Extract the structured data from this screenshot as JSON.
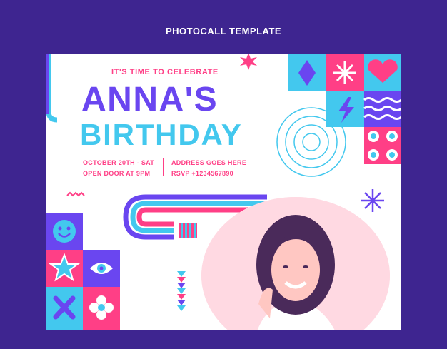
{
  "header": {
    "title": "PHOTOCALL TEMPLATE"
  },
  "card": {
    "kicker": "IT'S TIME TO CELEBRATE",
    "name": "ANNA'S",
    "title": "BIRTHDAY",
    "date_line": "OCTOBER 20TH - SAT",
    "door_line": "OPEN DOOR AT 9PM",
    "address_line": "ADDRESS GOES HERE",
    "rsvp_line": "RSVP +1234567890"
  },
  "colors": {
    "background": "#3e2590",
    "purple": "#6a46f0",
    "cyan": "#43c8ee",
    "pink": "#ff3f86",
    "white": "#ffffff"
  },
  "icons": [
    "smiley-icon",
    "star-icon",
    "eye-icon",
    "x-icon",
    "flower-icon",
    "heart-icon",
    "sparkle-icon",
    "lightning-icon",
    "wave-icon",
    "concentric-circle-icon",
    "burst-icon"
  ]
}
